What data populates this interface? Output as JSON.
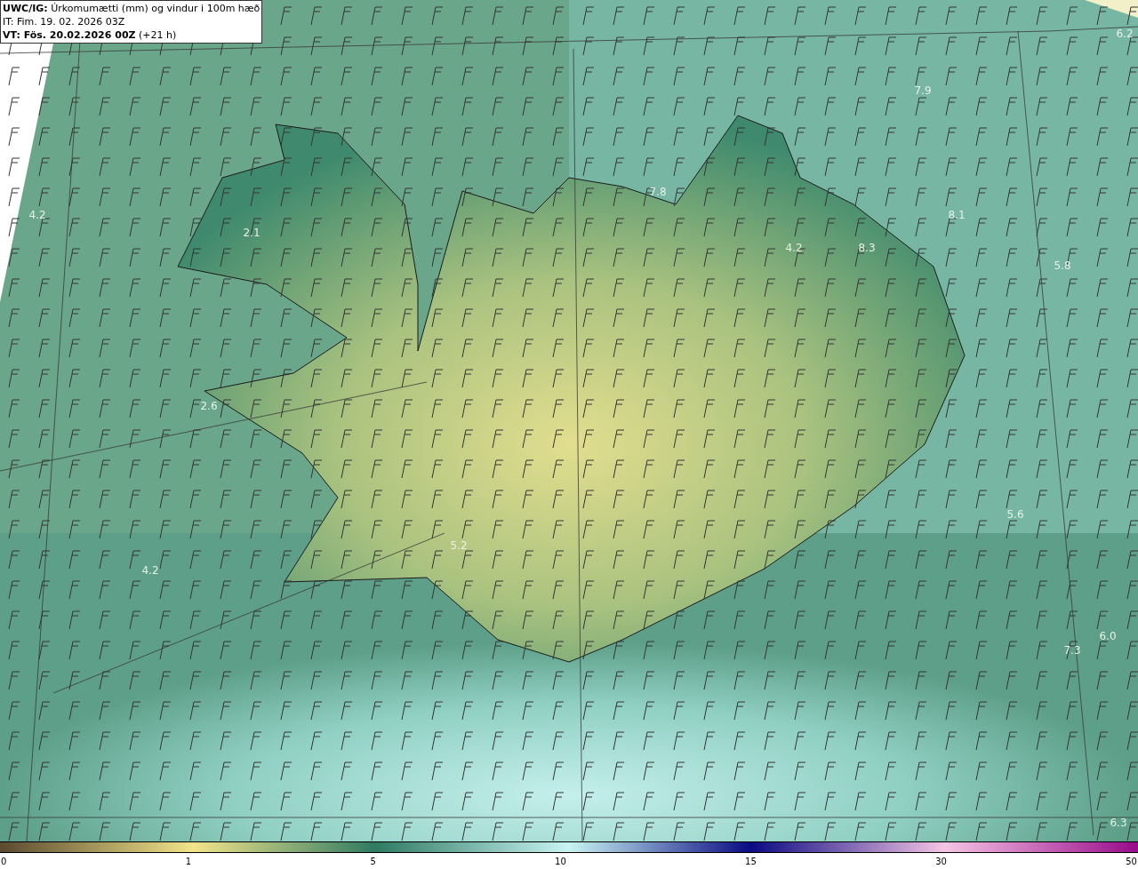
{
  "header": {
    "lines": [
      "**UWC/IG:** Úrkomumætti (mm) og vindur i 100m hæð",
      "IT: Fim. 19. 02. 2026 03Z",
      "**VT: Fös. 20.02.2026 00Z** (+21 h)"
    ]
  },
  "map": {
    "value_labels": [
      {
        "text": "6.2"
      },
      {
        "text": "7.9"
      },
      {
        "text": "4.2"
      },
      {
        "text": "7.8"
      },
      {
        "text": "8.1"
      },
      {
        "text": "4.2"
      },
      {
        "text": "8.3"
      },
      {
        "text": "2.1"
      },
      {
        "text": "5.8"
      },
      {
        "text": "2.6"
      },
      {
        "text": "5.6"
      },
      {
        "text": "5.2"
      },
      {
        "text": "4.2"
      },
      {
        "text": "6.0"
      },
      {
        "text": "7.3"
      },
      {
        "text": "6.3"
      }
    ]
  },
  "colorbar": {
    "ticks": [
      "0",
      "1",
      "5",
      "10",
      "15",
      "30",
      "50"
    ]
  }
}
